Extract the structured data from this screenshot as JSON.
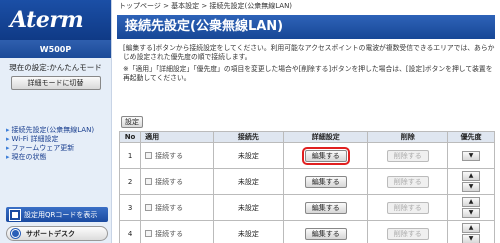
{
  "sidebar": {
    "logo": "Aterm",
    "model": "W500P",
    "current_setting": "現在の設定:かんたんモード",
    "detail_mode_button": "詳細モードに切替",
    "nav": [
      "接続先設定(公衆無線LAN)",
      "Wi-Fi 詳細設定",
      "ファームウェア更新",
      "現在の状態"
    ],
    "qr_button": "設定用QRコードを表示",
    "support_button": "サポートデスク"
  },
  "main": {
    "breadcrumb": "トップページ > 基本設定 > 接続先設定(公衆無線LAN)",
    "title": "接続先設定(公衆無線LAN)",
    "description": [
      "[編集する]ボタンから接続設定をしてください。利用可能なアクセスポイントの電波が複数受信できるエリアでは、あらかじめ設定された優先度の順で接続します。",
      "※「適用」「詳細設定」「優先度」の項目を変更した場合や[削除する]ボタンを押した場合は、[設定]ボタンを押して装置を再起動してください。"
    ],
    "setting_button": "設定",
    "table": {
      "headers": [
        "No",
        "適用",
        "接続先",
        "詳細設定",
        "削除",
        "優先度"
      ],
      "enable_label": "接続する",
      "edit_label": "編集する",
      "delete_label": "削除する",
      "rows": [
        {
          "no": "1",
          "connection": "未設定"
        },
        {
          "no": "2",
          "connection": "未設定"
        },
        {
          "no": "3",
          "connection": "未設定"
        },
        {
          "no": "4",
          "connection": "未設定"
        }
      ]
    }
  }
}
